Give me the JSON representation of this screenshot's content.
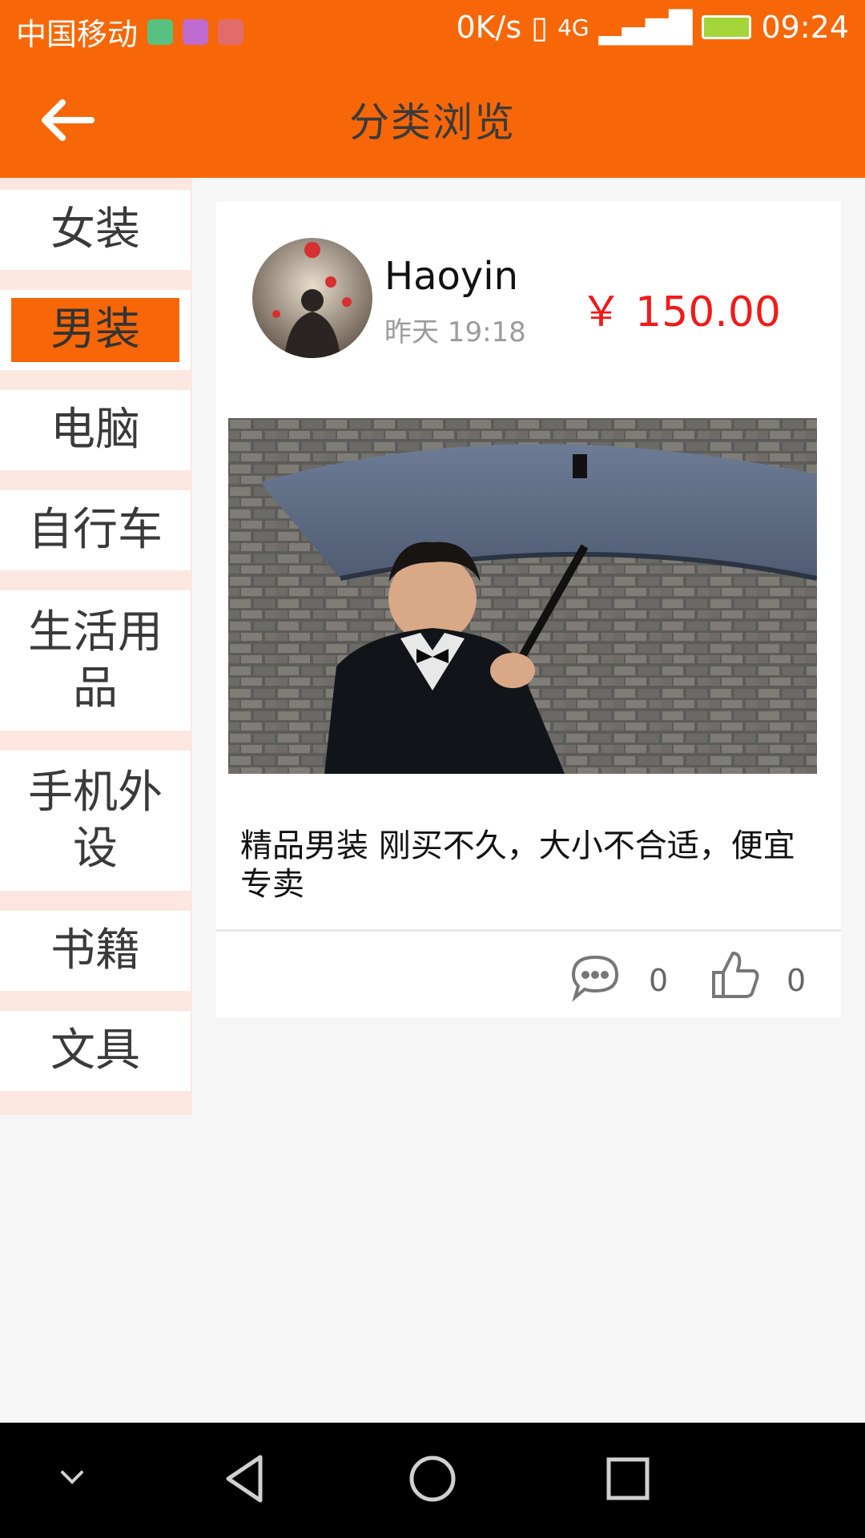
{
  "statusbar": {
    "carrier": "中国移动",
    "speed": "0K/s",
    "network": "4G",
    "time": "09:24"
  },
  "header": {
    "title": "分类浏览"
  },
  "sidebar": {
    "items": [
      {
        "label": "女装"
      },
      {
        "label": "男装"
      },
      {
        "label": "电脑"
      },
      {
        "label": "自行车"
      },
      {
        "label": "生活用品"
      },
      {
        "label": "手机外设"
      },
      {
        "label": "书籍"
      },
      {
        "label": "文具"
      }
    ],
    "active_index": 1
  },
  "post": {
    "user": "Haoyin",
    "time": "昨天 19:18",
    "price": "￥ 150.00",
    "description": "精品男装  刚买不久，大小不合适，便宜专卖",
    "comment_count": "0",
    "like_count": "0"
  },
  "colors": {
    "accent": "#f76707",
    "price": "#ef1b1b",
    "sidebar_bg": "#fde7e0"
  }
}
